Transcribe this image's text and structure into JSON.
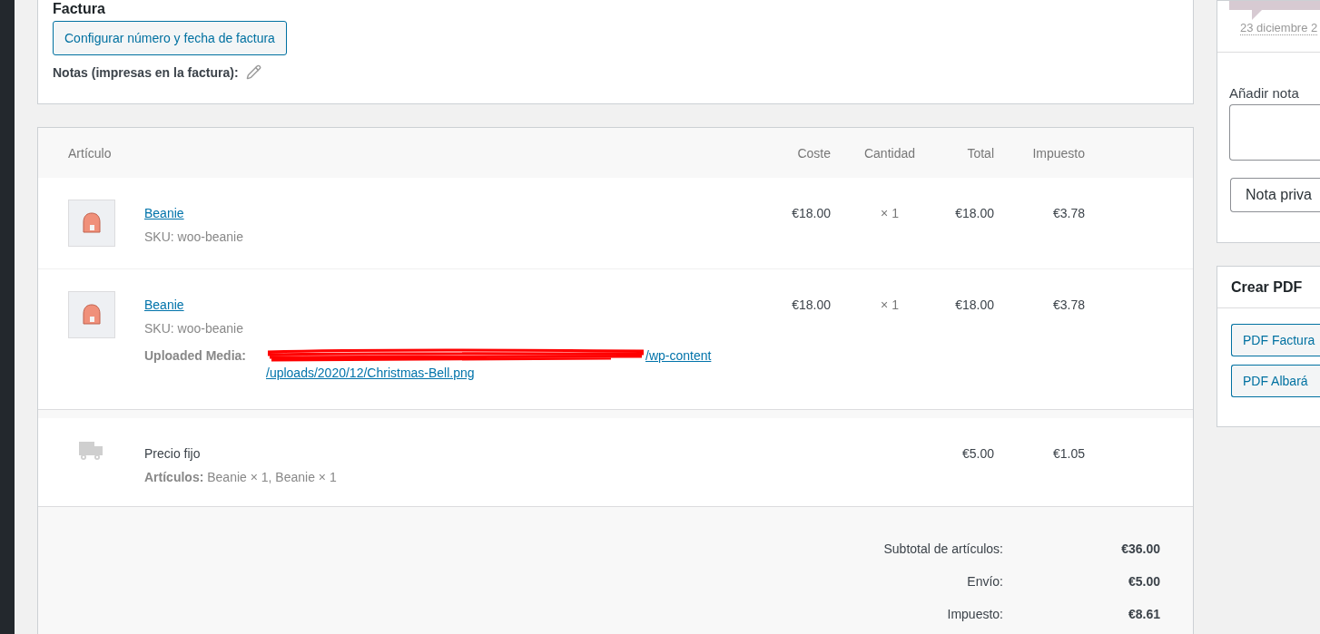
{
  "invoice": {
    "heading": "Factura",
    "configure_button": "Configurar número y fecha de factura",
    "notes_label": "Notas (impresas en la factura):"
  },
  "items": {
    "columns": [
      "Artículo",
      "Coste",
      "Cantidad",
      "Total",
      "Impuesto"
    ],
    "rows": [
      {
        "name": "Beanie",
        "sku_label": "SKU:",
        "sku": "woo-beanie",
        "cost": "€18.00",
        "qty": "× 1",
        "total": "€18.00",
        "tax": "€3.78"
      },
      {
        "name": "Beanie",
        "sku_label": "SKU:",
        "sku": "woo-beanie",
        "cost": "€18.00",
        "qty": "× 1",
        "total": "€18.00",
        "tax": "€3.78",
        "meta": {
          "label": "Uploaded Media:",
          "link_lines": [
            "/wp-content",
            "/uploads/2020/12/Christmas-Bell.png"
          ]
        }
      }
    ],
    "shipping": {
      "name": "Precio fijo",
      "items_label": "Artículos:",
      "items": "Beanie × 1, Beanie × 1",
      "total": "€5.00",
      "tax": "€1.05"
    },
    "totals": [
      {
        "label": "Subtotal de artículos:",
        "value": "€36.00"
      },
      {
        "label": "Envío:",
        "value": "€5.00"
      },
      {
        "label": "Impuesto:",
        "value": "€8.61"
      }
    ]
  },
  "sidebar": {
    "note_date": "23 diciembre 2",
    "add_note_label": "Añadir nota",
    "note_type": "Nota priva",
    "pdf": {
      "title": "Crear PDF",
      "buttons": [
        "PDF Factura",
        "PDF Albará"
      ]
    }
  }
}
